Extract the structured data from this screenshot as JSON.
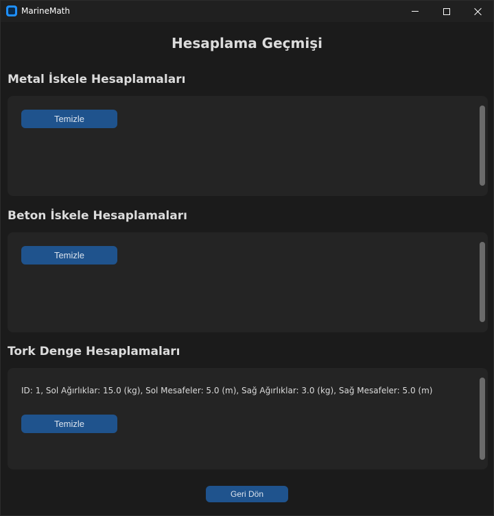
{
  "window": {
    "title": "MarineMath",
    "icon": "app-icon"
  },
  "page": {
    "title": "Hesaplama Geçmişi"
  },
  "sections": [
    {
      "title": "Metal İskele Hesaplamaları",
      "records": [],
      "clear_label": "Temizle"
    },
    {
      "title": "Beton İskele Hesaplamaları",
      "records": [],
      "clear_label": "Temizle"
    },
    {
      "title": "Tork Denge Hesaplamaları",
      "records": [
        "ID: 1, Sol Ağırlıklar: 15.0 (kg), Sol Mesafeler: 5.0 (m), Sağ Ağırlıklar: 3.0 (kg), Sağ Mesafeler: 5.0 (m)"
      ],
      "clear_label": "Temizle"
    }
  ],
  "footer": {
    "back_label": "Geri Dön"
  },
  "colors": {
    "background": "#1b1b1b",
    "panel": "#242424",
    "button": "#1f538d",
    "scrollbar": "#6b6b6b"
  }
}
